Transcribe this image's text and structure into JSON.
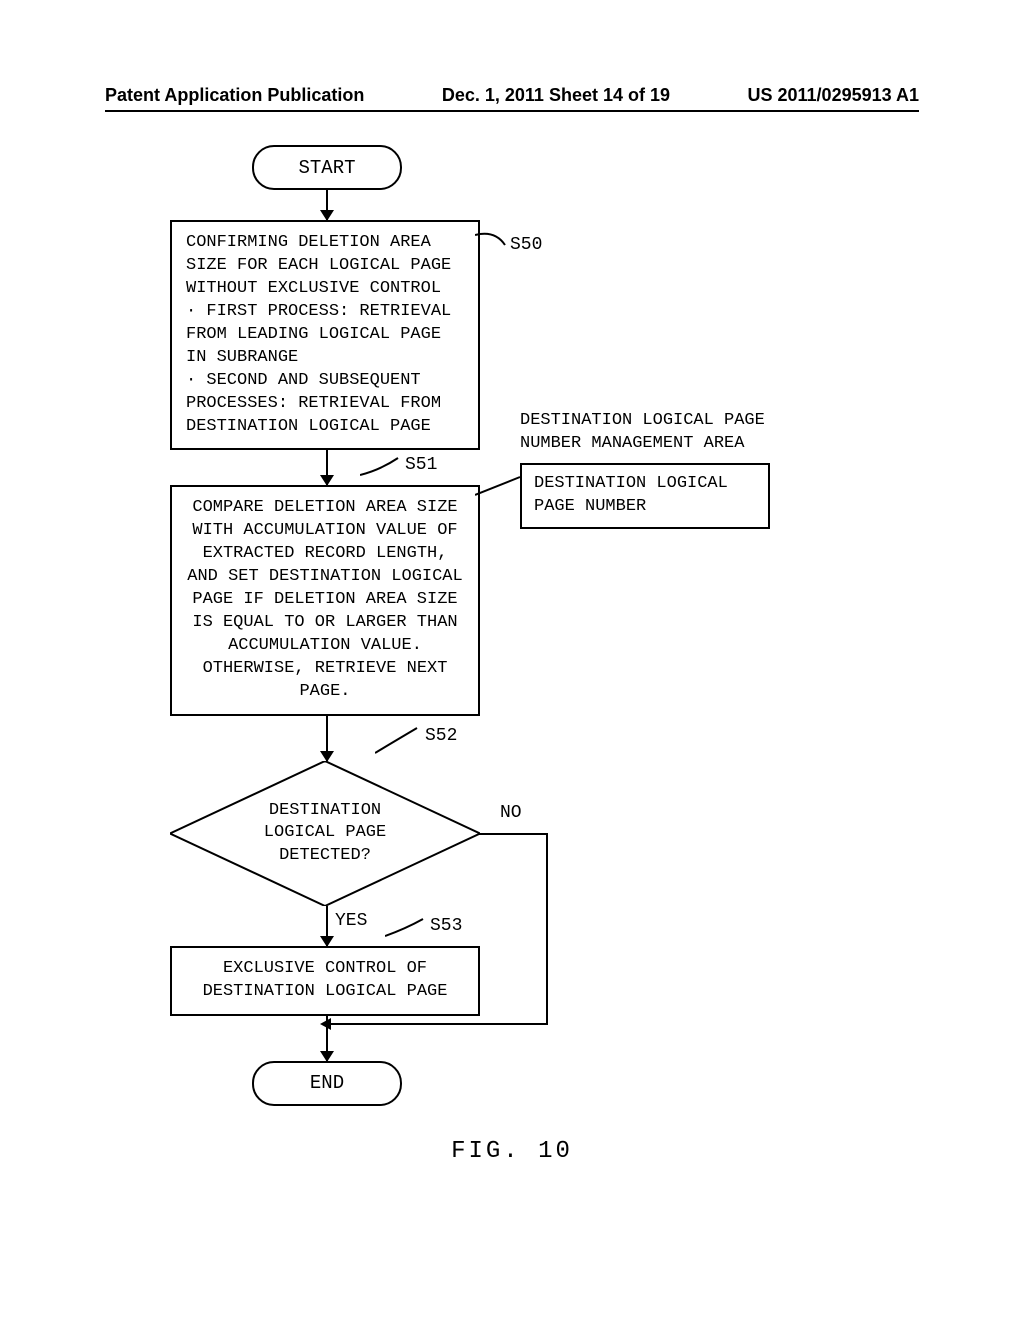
{
  "header": {
    "left": "Patent Application Publication",
    "center": "Dec. 1, 2011   Sheet 14 of 19",
    "right": "US 2011/0295913 A1"
  },
  "flowchart": {
    "start": "START",
    "end": "END",
    "s50": "CONFIRMING DELETION AREA SIZE FOR EACH LOGICAL PAGE WITHOUT EXCLUSIVE CONTROL\n· FIRST PROCESS: RETRIEVAL FROM LEADING LOGICAL PAGE IN SUBRANGE\n· SECOND AND SUBSEQUENT PROCESSES: RETRIEVAL FROM DESTINATION LOGICAL PAGE",
    "s50_label": "S50",
    "s51": "COMPARE DELETION AREA SIZE WITH ACCUMULATION VALUE OF EXTRACTED RECORD LENGTH, AND SET DESTINATION LOGICAL PAGE IF DELETION AREA SIZE IS EQUAL TO OR LARGER THAN ACCUMULATION VALUE. OTHERWISE, RETRIEVE NEXT PAGE.",
    "s51_label": "S51",
    "s52": "DESTINATION\nLOGICAL PAGE\nDETECTED?",
    "s52_label": "S52",
    "s52_yes": "YES",
    "s52_no": "NO",
    "s53": "EXCLUSIVE CONTROL OF DESTINATION LOGICAL PAGE",
    "s53_label": "S53",
    "annotation_title": "DESTINATION LOGICAL PAGE NUMBER MANAGEMENT AREA",
    "annotation_content": "DESTINATION LOGICAL PAGE NUMBER"
  },
  "figure_label": "FIG. 10"
}
